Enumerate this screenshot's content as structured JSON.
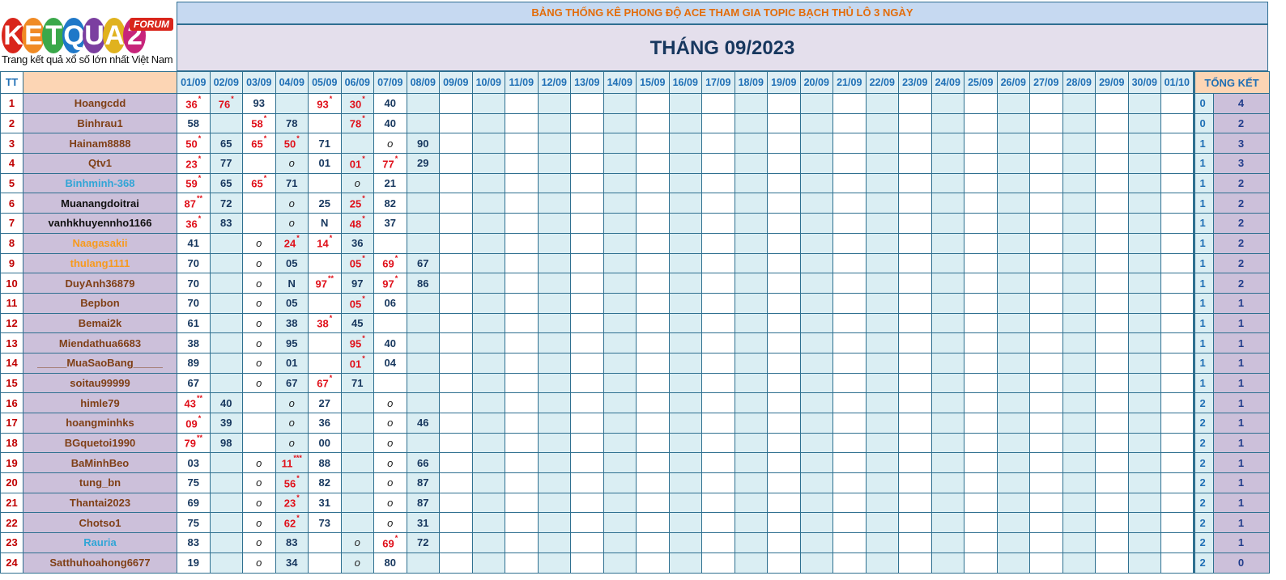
{
  "logo": {
    "brand": "KETQUA2",
    "badge": "FORUM",
    "tagline": "Trang kết quả xổ số lớn nhất Việt Nam"
  },
  "header": {
    "subtitle": "BẢNG THỐNG KÊ PHONG ĐỘ ACE THAM GIA TOPIC BẠCH THỦ LÔ 3 NGÀY",
    "title": "THÁNG 09/2023"
  },
  "columns": {
    "tt": "TT",
    "name": "",
    "dates": [
      "01/09",
      "02/09",
      "03/09",
      "04/09",
      "05/09",
      "06/09",
      "07/09",
      "08/09",
      "09/09",
      "10/09",
      "11/09",
      "12/09",
      "13/09",
      "14/09",
      "15/09",
      "16/09",
      "17/09",
      "18/09",
      "19/09",
      "20/09",
      "21/09",
      "22/09",
      "23/09",
      "24/09",
      "25/09",
      "26/09",
      "27/09",
      "28/09",
      "29/09",
      "30/09",
      "01/10"
    ],
    "summary": "TỔNG KẾT"
  },
  "colors": {
    "default_name": "#7f3f16",
    "blue_name": "#31a5d6",
    "orange_name": "#f79a1e",
    "black_name": "#111111",
    "hit": "#e0101a",
    "value": "#17375e"
  },
  "rows": [
    {
      "tt": "1",
      "name": "Hoangcdd",
      "color": "default",
      "cells": [
        [
          "36",
          "*"
        ],
        [
          "76",
          "*"
        ],
        [
          "93",
          ""
        ],
        [
          "",
          ""
        ],
        [
          "93",
          "*"
        ],
        [
          "30",
          "*"
        ],
        [
          "40",
          ""
        ],
        [
          "",
          ""
        ]
      ],
      "s1": "0",
      "s2": "4"
    },
    {
      "tt": "2",
      "name": "Binhrau1",
      "color": "default",
      "cells": [
        [
          "58",
          ""
        ],
        [
          "",
          ""
        ],
        [
          "58",
          "*"
        ],
        [
          "78",
          ""
        ],
        [
          "",
          ""
        ],
        [
          "78",
          "*"
        ],
        [
          "40",
          ""
        ],
        [
          "",
          ""
        ]
      ],
      "s1": "0",
      "s2": "2"
    },
    {
      "tt": "3",
      "name": "Hainam8888",
      "color": "default",
      "cells": [
        [
          "50",
          "*"
        ],
        [
          "65",
          ""
        ],
        [
          "65",
          "*"
        ],
        [
          "50",
          "*"
        ],
        [
          "71",
          ""
        ],
        [
          "",
          ""
        ],
        [
          "o",
          ""
        ],
        [
          "90",
          ""
        ]
      ],
      "s1": "1",
      "s2": "3"
    },
    {
      "tt": "4",
      "name": "Qtv1",
      "color": "default",
      "cells": [
        [
          "23",
          "*"
        ],
        [
          "77",
          ""
        ],
        [
          "",
          ""
        ],
        [
          "o",
          ""
        ],
        [
          "01",
          ""
        ],
        [
          "01",
          "*"
        ],
        [
          "77",
          "*"
        ],
        [
          "29",
          ""
        ]
      ],
      "s1": "1",
      "s2": "3"
    },
    {
      "tt": "5",
      "name": "Binhminh-368",
      "color": "blue",
      "cells": [
        [
          "59",
          "*"
        ],
        [
          "65",
          ""
        ],
        [
          "65",
          "*"
        ],
        [
          "71",
          ""
        ],
        [
          "",
          ""
        ],
        [
          "o",
          ""
        ],
        [
          "21",
          ""
        ],
        [
          "",
          ""
        ]
      ],
      "s1": "1",
      "s2": "2"
    },
    {
      "tt": "6",
      "name": "Muanangdoitrai",
      "color": "black",
      "cells": [
        [
          "87",
          "**"
        ],
        [
          "72",
          ""
        ],
        [
          "",
          ""
        ],
        [
          "o",
          ""
        ],
        [
          "25",
          ""
        ],
        [
          "25",
          "*"
        ],
        [
          "82",
          ""
        ],
        [
          "",
          ""
        ]
      ],
      "s1": "1",
      "s2": "2"
    },
    {
      "tt": "7",
      "name": "vanhkhuyennho1166",
      "color": "black",
      "cells": [
        [
          "36",
          "*"
        ],
        [
          "83",
          ""
        ],
        [
          "",
          ""
        ],
        [
          "o",
          ""
        ],
        [
          "N",
          ""
        ],
        [
          "48",
          "*"
        ],
        [
          "37",
          ""
        ],
        [
          "",
          ""
        ]
      ],
      "s1": "1",
      "s2": "2"
    },
    {
      "tt": "8",
      "name": "Naagasakii",
      "color": "orange",
      "cells": [
        [
          "41",
          ""
        ],
        [
          "",
          ""
        ],
        [
          "o",
          ""
        ],
        [
          "24",
          "*"
        ],
        [
          "14",
          "*"
        ],
        [
          "36",
          ""
        ],
        [
          "",
          ""
        ],
        [
          "",
          ""
        ]
      ],
      "s1": "1",
      "s2": "2"
    },
    {
      "tt": "9",
      "name": "thulang1111",
      "color": "orange",
      "cells": [
        [
          "70",
          ""
        ],
        [
          "",
          ""
        ],
        [
          "o",
          ""
        ],
        [
          "05",
          ""
        ],
        [
          "",
          ""
        ],
        [
          "05",
          "*"
        ],
        [
          "69",
          "*"
        ],
        [
          "67",
          ""
        ]
      ],
      "s1": "1",
      "s2": "2"
    },
    {
      "tt": "10",
      "name": "DuyAnh36879",
      "color": "default",
      "cells": [
        [
          "70",
          ""
        ],
        [
          "",
          ""
        ],
        [
          "o",
          ""
        ],
        [
          "N",
          ""
        ],
        [
          "97",
          "**"
        ],
        [
          "97",
          ""
        ],
        [
          "97",
          "*"
        ],
        [
          "86",
          ""
        ]
      ],
      "s1": "1",
      "s2": "2"
    },
    {
      "tt": "11",
      "name": "Bepbon",
      "color": "default",
      "cells": [
        [
          "70",
          ""
        ],
        [
          "",
          ""
        ],
        [
          "o",
          ""
        ],
        [
          "05",
          ""
        ],
        [
          "",
          ""
        ],
        [
          "05",
          "*"
        ],
        [
          "06",
          ""
        ],
        [
          "",
          ""
        ]
      ],
      "s1": "1",
      "s2": "1"
    },
    {
      "tt": "12",
      "name": "Bemai2k",
      "color": "default",
      "cells": [
        [
          "61",
          ""
        ],
        [
          "",
          ""
        ],
        [
          "o",
          ""
        ],
        [
          "38",
          ""
        ],
        [
          "38",
          "*"
        ],
        [
          "45",
          ""
        ],
        [
          "",
          ""
        ],
        [
          "",
          ""
        ]
      ],
      "s1": "1",
      "s2": "1"
    },
    {
      "tt": "13",
      "name": "Miendathua6683",
      "color": "default",
      "cells": [
        [
          "38",
          ""
        ],
        [
          "",
          ""
        ],
        [
          "o",
          ""
        ],
        [
          "95",
          ""
        ],
        [
          "",
          ""
        ],
        [
          "95",
          "*"
        ],
        [
          "40",
          ""
        ],
        [
          "",
          ""
        ]
      ],
      "s1": "1",
      "s2": "1"
    },
    {
      "tt": "14",
      "name": "_____MuaSaoBang_____",
      "color": "default",
      "cells": [
        [
          "89",
          ""
        ],
        [
          "",
          ""
        ],
        [
          "o",
          ""
        ],
        [
          "01",
          ""
        ],
        [
          "",
          ""
        ],
        [
          "01",
          "*"
        ],
        [
          "04",
          ""
        ],
        [
          "",
          ""
        ]
      ],
      "s1": "1",
      "s2": "1"
    },
    {
      "tt": "15",
      "name": "soitau99999",
      "color": "default",
      "cells": [
        [
          "67",
          ""
        ],
        [
          "",
          ""
        ],
        [
          "o",
          ""
        ],
        [
          "67",
          ""
        ],
        [
          "67",
          "*"
        ],
        [
          "71",
          ""
        ],
        [
          "",
          ""
        ],
        [
          "",
          ""
        ]
      ],
      "s1": "1",
      "s2": "1"
    },
    {
      "tt": "16",
      "name": "himle79",
      "color": "default",
      "cells": [
        [
          "43",
          "**"
        ],
        [
          "40",
          ""
        ],
        [
          "",
          ""
        ],
        [
          "o",
          ""
        ],
        [
          "27",
          ""
        ],
        [
          "",
          ""
        ],
        [
          "o",
          ""
        ],
        [
          "",
          ""
        ]
      ],
      "s1": "2",
      "s2": "1"
    },
    {
      "tt": "17",
      "name": "hoangminhks",
      "color": "default",
      "cells": [
        [
          "09",
          "*"
        ],
        [
          "39",
          ""
        ],
        [
          "",
          ""
        ],
        [
          "o",
          ""
        ],
        [
          "36",
          ""
        ],
        [
          "",
          ""
        ],
        [
          "o",
          ""
        ],
        [
          "46",
          ""
        ]
      ],
      "s1": "2",
      "s2": "1"
    },
    {
      "tt": "18",
      "name": "BGquetoi1990",
      "color": "default",
      "cells": [
        [
          "79",
          "**"
        ],
        [
          "98",
          ""
        ],
        [
          "",
          ""
        ],
        [
          "o",
          ""
        ],
        [
          "00",
          ""
        ],
        [
          "",
          ""
        ],
        [
          "o",
          ""
        ],
        [
          "",
          ""
        ]
      ],
      "s1": "2",
      "s2": "1"
    },
    {
      "tt": "19",
      "name": "BaMinhBeo",
      "color": "default",
      "cells": [
        [
          "03",
          ""
        ],
        [
          "",
          ""
        ],
        [
          "o",
          ""
        ],
        [
          "11",
          "***"
        ],
        [
          "88",
          ""
        ],
        [
          "",
          ""
        ],
        [
          "o",
          ""
        ],
        [
          "66",
          ""
        ]
      ],
      "s1": "2",
      "s2": "1"
    },
    {
      "tt": "20",
      "name": "tung_bn",
      "color": "default",
      "cells": [
        [
          "75",
          ""
        ],
        [
          "",
          ""
        ],
        [
          "o",
          ""
        ],
        [
          "56",
          "*"
        ],
        [
          "82",
          ""
        ],
        [
          "",
          ""
        ],
        [
          "o",
          ""
        ],
        [
          "87",
          ""
        ]
      ],
      "s1": "2",
      "s2": "1"
    },
    {
      "tt": "21",
      "name": "Thantai2023",
      "color": "default",
      "cells": [
        [
          "69",
          ""
        ],
        [
          "",
          ""
        ],
        [
          "o",
          ""
        ],
        [
          "23",
          "*"
        ],
        [
          "31",
          ""
        ],
        [
          "",
          ""
        ],
        [
          "o",
          ""
        ],
        [
          "87",
          ""
        ]
      ],
      "s1": "2",
      "s2": "1"
    },
    {
      "tt": "22",
      "name": "Chotso1",
      "color": "default",
      "cells": [
        [
          "75",
          ""
        ],
        [
          "",
          ""
        ],
        [
          "o",
          ""
        ],
        [
          "62",
          "*"
        ],
        [
          "73",
          ""
        ],
        [
          "",
          ""
        ],
        [
          "o",
          ""
        ],
        [
          "31",
          ""
        ]
      ],
      "s1": "2",
      "s2": "1"
    },
    {
      "tt": "23",
      "name": "Rauria",
      "color": "blue",
      "cells": [
        [
          "83",
          ""
        ],
        [
          "",
          ""
        ],
        [
          "o",
          ""
        ],
        [
          "83",
          ""
        ],
        [
          "",
          ""
        ],
        [
          "o",
          ""
        ],
        [
          "69",
          "*"
        ],
        [
          "72",
          ""
        ]
      ],
      "s1": "2",
      "s2": "1"
    },
    {
      "tt": "24",
      "name": "Satthuhoahong6677",
      "color": "default",
      "cells": [
        [
          "19",
          ""
        ],
        [
          "",
          ""
        ],
        [
          "o",
          ""
        ],
        [
          "34",
          ""
        ],
        [
          "",
          ""
        ],
        [
          "o",
          ""
        ],
        [
          "80",
          ""
        ],
        [
          "",
          ""
        ]
      ],
      "s1": "2",
      "s2": "0"
    }
  ]
}
